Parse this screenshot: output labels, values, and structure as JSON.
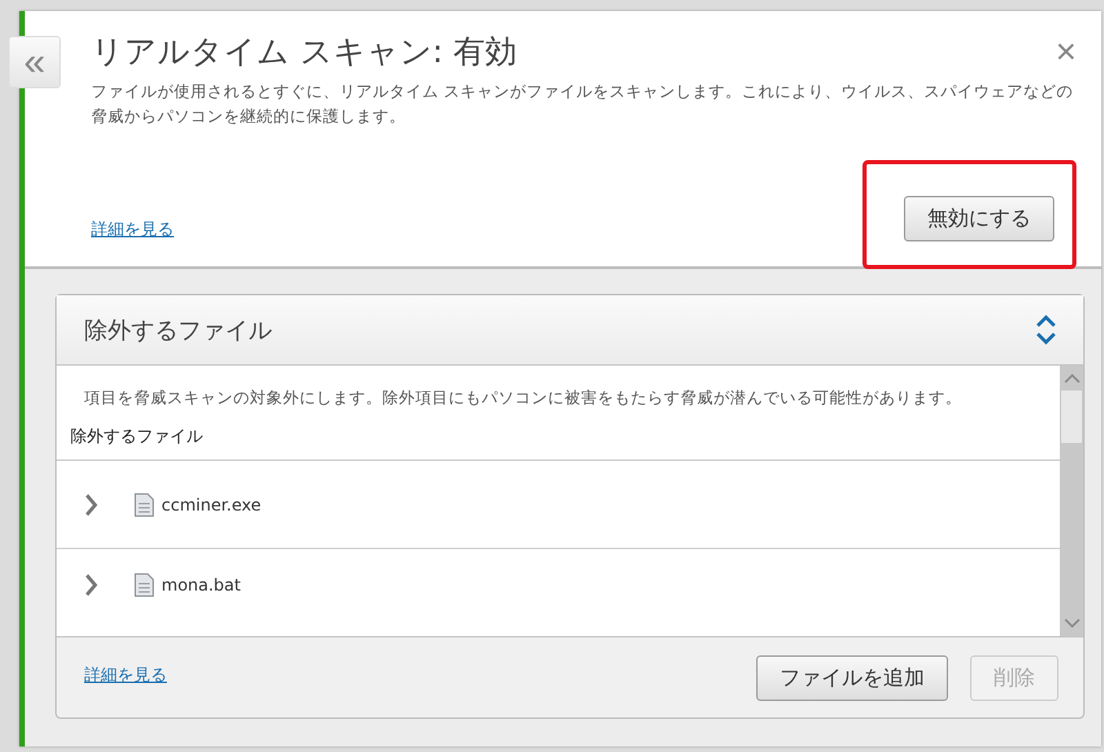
{
  "header": {
    "back_label": "«",
    "title": "リアルタイム スキャン: 有効",
    "close_label": "×",
    "description": "ファイルが使用されるとすぐに、リアルタイム スキャンがファイルをスキャンします。これにより、ウイルス、スパイウェアなどの脅威からパソコンを継続的に保護します。",
    "details_link": "詳細を見る",
    "toggle_button": {
      "label": "無効にする",
      "highlighted": true
    }
  },
  "exclusions": {
    "title": "除外するファイル",
    "expanded": true,
    "description": "項目を脅威スキャンの対象外にします。除外項目にもパソコンに被害をもたらす脅威が潜んでいる可能性があります。",
    "list_heading": "除外するファイル",
    "files": [
      {
        "name": "ccminer.exe",
        "expanded": false
      },
      {
        "name": "mona.bat",
        "expanded": false
      }
    ],
    "details_link": "詳細を見る",
    "buttons": [
      {
        "label": "ファイルを追加",
        "disabled": false
      },
      {
        "label": "削除",
        "disabled": true
      }
    ]
  }
}
